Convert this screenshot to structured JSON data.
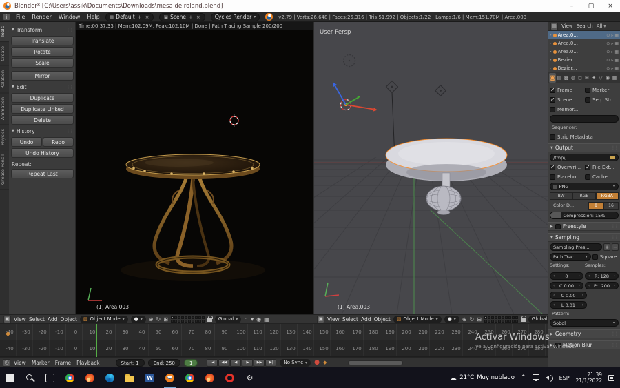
{
  "titlebar": {
    "title": "Blender* [C:\\Users\\assik\\Documents\\Downloads\\mesa de roland.blend]",
    "minimize": "–",
    "maximize": "▢",
    "close": "×"
  },
  "menubar": {
    "editor_icon": "i",
    "menus": [
      "File",
      "Render",
      "Window",
      "Help"
    ],
    "layout": "Default",
    "scene": "Scene",
    "engine": "Cycles Render",
    "add": "+",
    "remove": "×",
    "stats": "v2.79 | Verts:26,648 | Faces:25,316 | Tris:51,992 | Objects:1/22 | Lamps:1/6 | Mem:151.70M | Area.003"
  },
  "toolshelf": {
    "tabs": [
      "Tools",
      "Create",
      "Relation",
      "Animation",
      "Physics",
      "Grease Pencil"
    ],
    "transform": {
      "title": "Transform",
      "buttons": [
        "Translate",
        "Rotate",
        "Scale"
      ],
      "mirror": "Mirror"
    },
    "edit": {
      "title": "Edit",
      "buttons": [
        "Duplicate",
        "Duplicate Linked",
        "Delete"
      ]
    },
    "history": {
      "title": "History",
      "undo": "Undo",
      "redo": "Redo",
      "undo_history": "Undo History",
      "repeat_label": "Repeat:",
      "repeat_last": "Repeat Last"
    }
  },
  "render_view": {
    "stats": "Time:00:37.33 | Mem:102.09M, Peak:102.10M | Done | Path Tracing Sample 200/200",
    "label": "(1) Area.003"
  },
  "viewport3d": {
    "view_label": "User Persp",
    "label": "(1) Area.003"
  },
  "viewport_header": {
    "menus": [
      "View",
      "Select",
      "Add",
      "Object"
    ],
    "mode": "Object Mode",
    "orientation": "Global"
  },
  "timeline": {
    "menus": [
      "View",
      "Marker",
      "Frame",
      "Playback"
    ],
    "start": "Start: 1",
    "end": "End: 250",
    "frame": "1",
    "sync": "No Sync",
    "transport": [
      "|◀",
      "◀◀",
      "◀",
      "▶",
      "▶▶",
      "▶|"
    ],
    "ruler": [
      "-40",
      "-30",
      "-20",
      "-10",
      "0",
      "10",
      "20",
      "30",
      "40",
      "50",
      "60",
      "70",
      "80",
      "90",
      "100",
      "110",
      "120",
      "130",
      "140",
      "150",
      "160",
      "170",
      "180",
      "190",
      "200",
      "210",
      "220",
      "230",
      "240",
      "250",
      "260",
      "270",
      "280"
    ]
  },
  "outliner": {
    "header": {
      "view": "View",
      "search": "Search",
      "display": "All"
    },
    "items": [
      {
        "label": "Area.0...",
        "active": true
      },
      {
        "label": "Area.0..."
      },
      {
        "label": "Area.0..."
      },
      {
        "label": "Bezier..."
      },
      {
        "label": "Bezier..."
      }
    ]
  },
  "properties": {
    "tabs": [
      {
        "name": "render",
        "glyph": "◙",
        "active": true
      },
      {
        "name": "render-layers",
        "glyph": "▤"
      },
      {
        "name": "scene",
        "glyph": "▩"
      },
      {
        "name": "world",
        "glyph": "◍"
      },
      {
        "name": "object",
        "glyph": "◻"
      },
      {
        "name": "constraints",
        "glyph": "⊞"
      },
      {
        "name": "modifiers",
        "glyph": "✦"
      },
      {
        "name": "object-data",
        "glyph": "▽"
      },
      {
        "name": "material",
        "glyph": "◉"
      },
      {
        "name": "texture",
        "glyph": "▦"
      }
    ],
    "metadata": {
      "frame": "Frame",
      "marker": "Marker",
      "scene": "Scene",
      "seq_strip": "Seq. Str...",
      "memory": "Memor...",
      "sequencer_label": "Sequencer:",
      "strip_metadata": "Strip Metadata"
    },
    "output": {
      "title": "Output",
      "path": "/tmp\\",
      "overwrite": "Overwri...",
      "file_ext": "File Ext...",
      "placeholder": "Placeho...",
      "cache": "Cache...",
      "format": "PNG",
      "color_modes": [
        "BW",
        "RGB",
        "RGBA"
      ],
      "color_depth_label": "Color D...",
      "depths": [
        "8",
        "16"
      ],
      "compression": "Compression: 15%"
    },
    "freestyle": {
      "title": "Freestyle"
    },
    "sampling": {
      "title": "Sampling",
      "preset": "Sampling Pres...",
      "integrator": "Path Trac...",
      "square": "Square",
      "settings_label": "Settings:",
      "samples_label": "Samples:",
      "seed": "0",
      "render_samples": "R: 128",
      "preview_samples": "Pr: 200",
      "clamp_direct": "C 0.00",
      "clamp_indirect": "C 0.00",
      "light_threshold": "L 0.01",
      "pattern_label": "Pattern:",
      "pattern": "Sobol"
    },
    "geometry": {
      "title": "Geometry"
    },
    "motion_blur": {
      "title": "Motion Blur"
    }
  },
  "taskbar": {
    "apps": [
      {
        "name": "start",
        "kind": "start"
      },
      {
        "name": "search",
        "kind": "search"
      },
      {
        "name": "task-view",
        "kind": "taskview"
      },
      {
        "name": "chrome",
        "kind": "chrome"
      },
      {
        "name": "firefox",
        "kind": "firefox"
      },
      {
        "name": "edge",
        "kind": "edge"
      },
      {
        "name": "file-explorer",
        "kind": "folder"
      },
      {
        "name": "word",
        "kind": "word",
        "glyph": "W"
      },
      {
        "name": "blender",
        "kind": "blender",
        "active": true
      },
      {
        "name": "chrome-2",
        "kind": "chrome"
      },
      {
        "name": "firefox-2",
        "kind": "firefox"
      },
      {
        "name": "opera",
        "kind": "opera"
      },
      {
        "name": "settings",
        "kind": "gear",
        "glyph": "⚙"
      }
    ],
    "tray": {
      "hidden_icons": "^",
      "temp": "21°C",
      "weather": "Muy nublado",
      "lang": "ESP",
      "time": "21:39",
      "date": "21/1/2022"
    }
  },
  "watermark": {
    "line1": "Activar Windows",
    "line2": "Ve a Configuración para activar Windows."
  }
}
